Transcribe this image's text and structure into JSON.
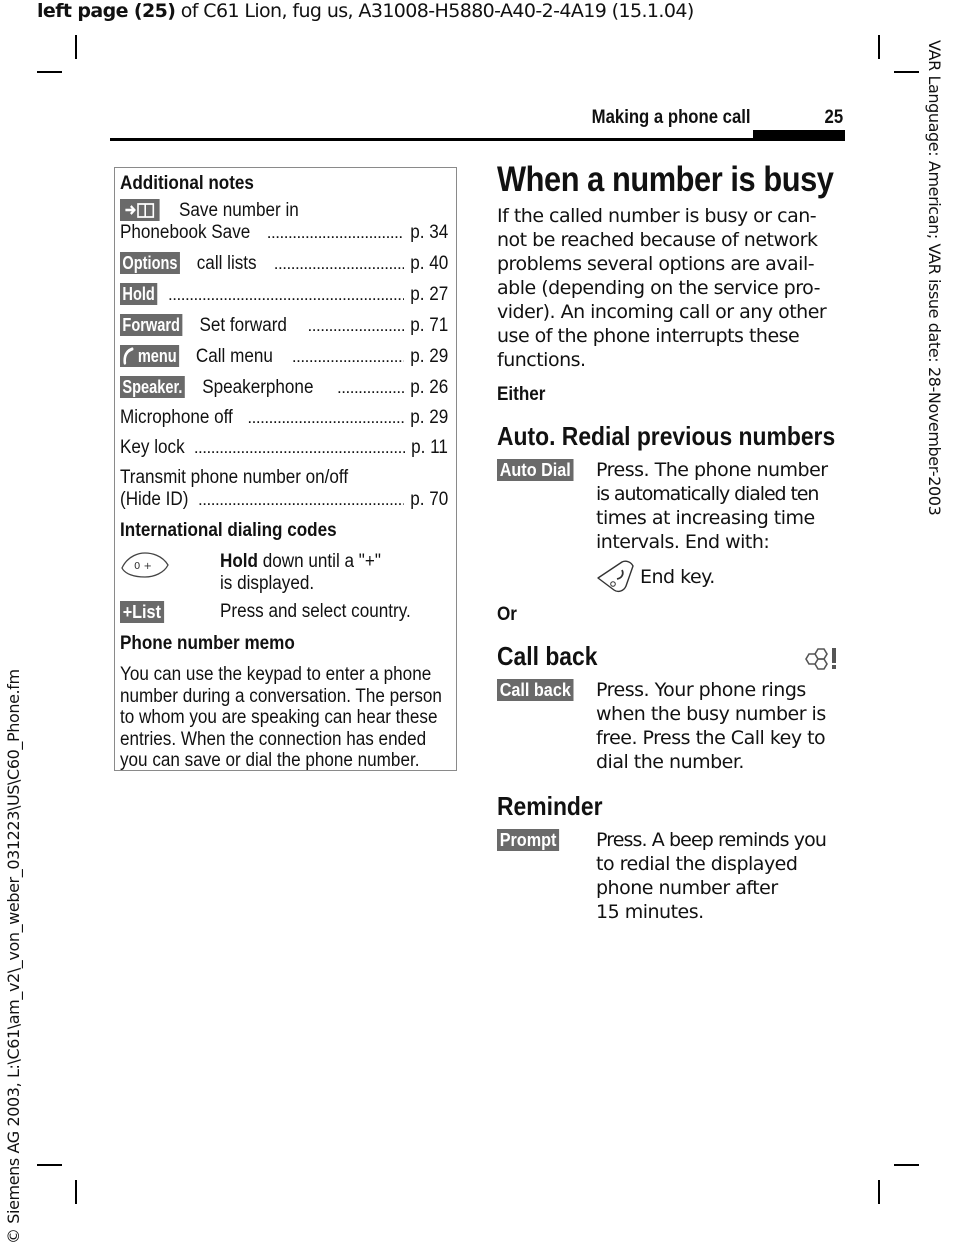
{
  "print_header": {
    "bold_part": "left page (25)",
    "rest": " of C61 Lion, fug us, A31008-H5880-A40-2-4A19 (15.1.04)"
  },
  "running_head": {
    "section_title": "Making a phone call",
    "page_number": "25"
  },
  "side_right_text": "VAR Language: American; VAR issue date: 28-November-2003",
  "side_left_text": "© Siemens AG 2003, L:\\C61\\am_v2\\_von_weber_031223\\US\\C60_Phone.fm",
  "notes_box": {
    "heading": "Additional notes",
    "entries": [
      {
        "key": "→📖",
        "text": "Save number in",
        "text2": "Phonebook Save",
        "page": "p. 34"
      },
      {
        "key": "Options",
        "text": "call lists",
        "page": "p. 40"
      },
      {
        "key": "Hold",
        "text": "",
        "page": "p. 27"
      },
      {
        "key": "Forward",
        "text": "Set forward",
        "page": "p. 71"
      },
      {
        "key": "menu",
        "text": "Call menu",
        "page": "p. 29"
      },
      {
        "key": "Speaker.",
        "text": "Speakerphone",
        "page": "p. 26"
      },
      {
        "key": "",
        "text": "Microphone off",
        "page": "p. 29"
      },
      {
        "key": "",
        "text": "Key lock",
        "page": "p. 11"
      },
      {
        "key": "",
        "text": "Transmit phone number on/off",
        "text2": "(Hide ID)",
        "page": "p. 70"
      }
    ],
    "intl_heading": "International dialing codes",
    "intl_steps": [
      {
        "key_icon": "0 +",
        "bold": "Hold",
        "text": " down until a \"+\"",
        "text2": "is displayed."
      },
      {
        "key": "+List",
        "text": "Press and select country."
      }
    ],
    "memo_heading": "Phone number memo",
    "memo_lines": [
      "You can use the keypad to enter a phone",
      "number during a conversation. The person",
      "to whom you are speaking can hear these",
      "entries. When the connection has ended",
      "you can save or dial the phone number."
    ]
  },
  "main": {
    "title": "When a number is busy",
    "intro_lines": [
      "If the called number is busy or can-",
      "not be reached because of network",
      "problems several options are avail-",
      "able (depending on the service pro-",
      "vider). An incoming call or any other",
      "use of the phone interrupts these",
      "functions."
    ],
    "either": "Either",
    "sections": [
      {
        "heading": "Auto. Redial previous numbers",
        "key": "Auto Dial",
        "lines": [
          "Press. The phone number",
          "is automatically dialed ten",
          "times at increasing time",
          "intervals. End with:"
        ],
        "end_key_label": "End key."
      },
      {
        "heading": "Call back",
        "key": "Call back",
        "lines": [
          "Press. Your phone rings",
          "when the busy number is",
          "free. Press the Call key to",
          "dial the number."
        ]
      },
      {
        "heading": "Reminder",
        "key": "Prompt",
        "lines": [
          "Press. A beep reminds you",
          "to redial the displayed",
          "phone number after",
          "15 minutes."
        ]
      }
    ],
    "or": "Or"
  },
  "colors": {
    "softkey_bg": "#6a6a6a",
    "text": "#111111",
    "box_border": "#8a8a8a"
  }
}
